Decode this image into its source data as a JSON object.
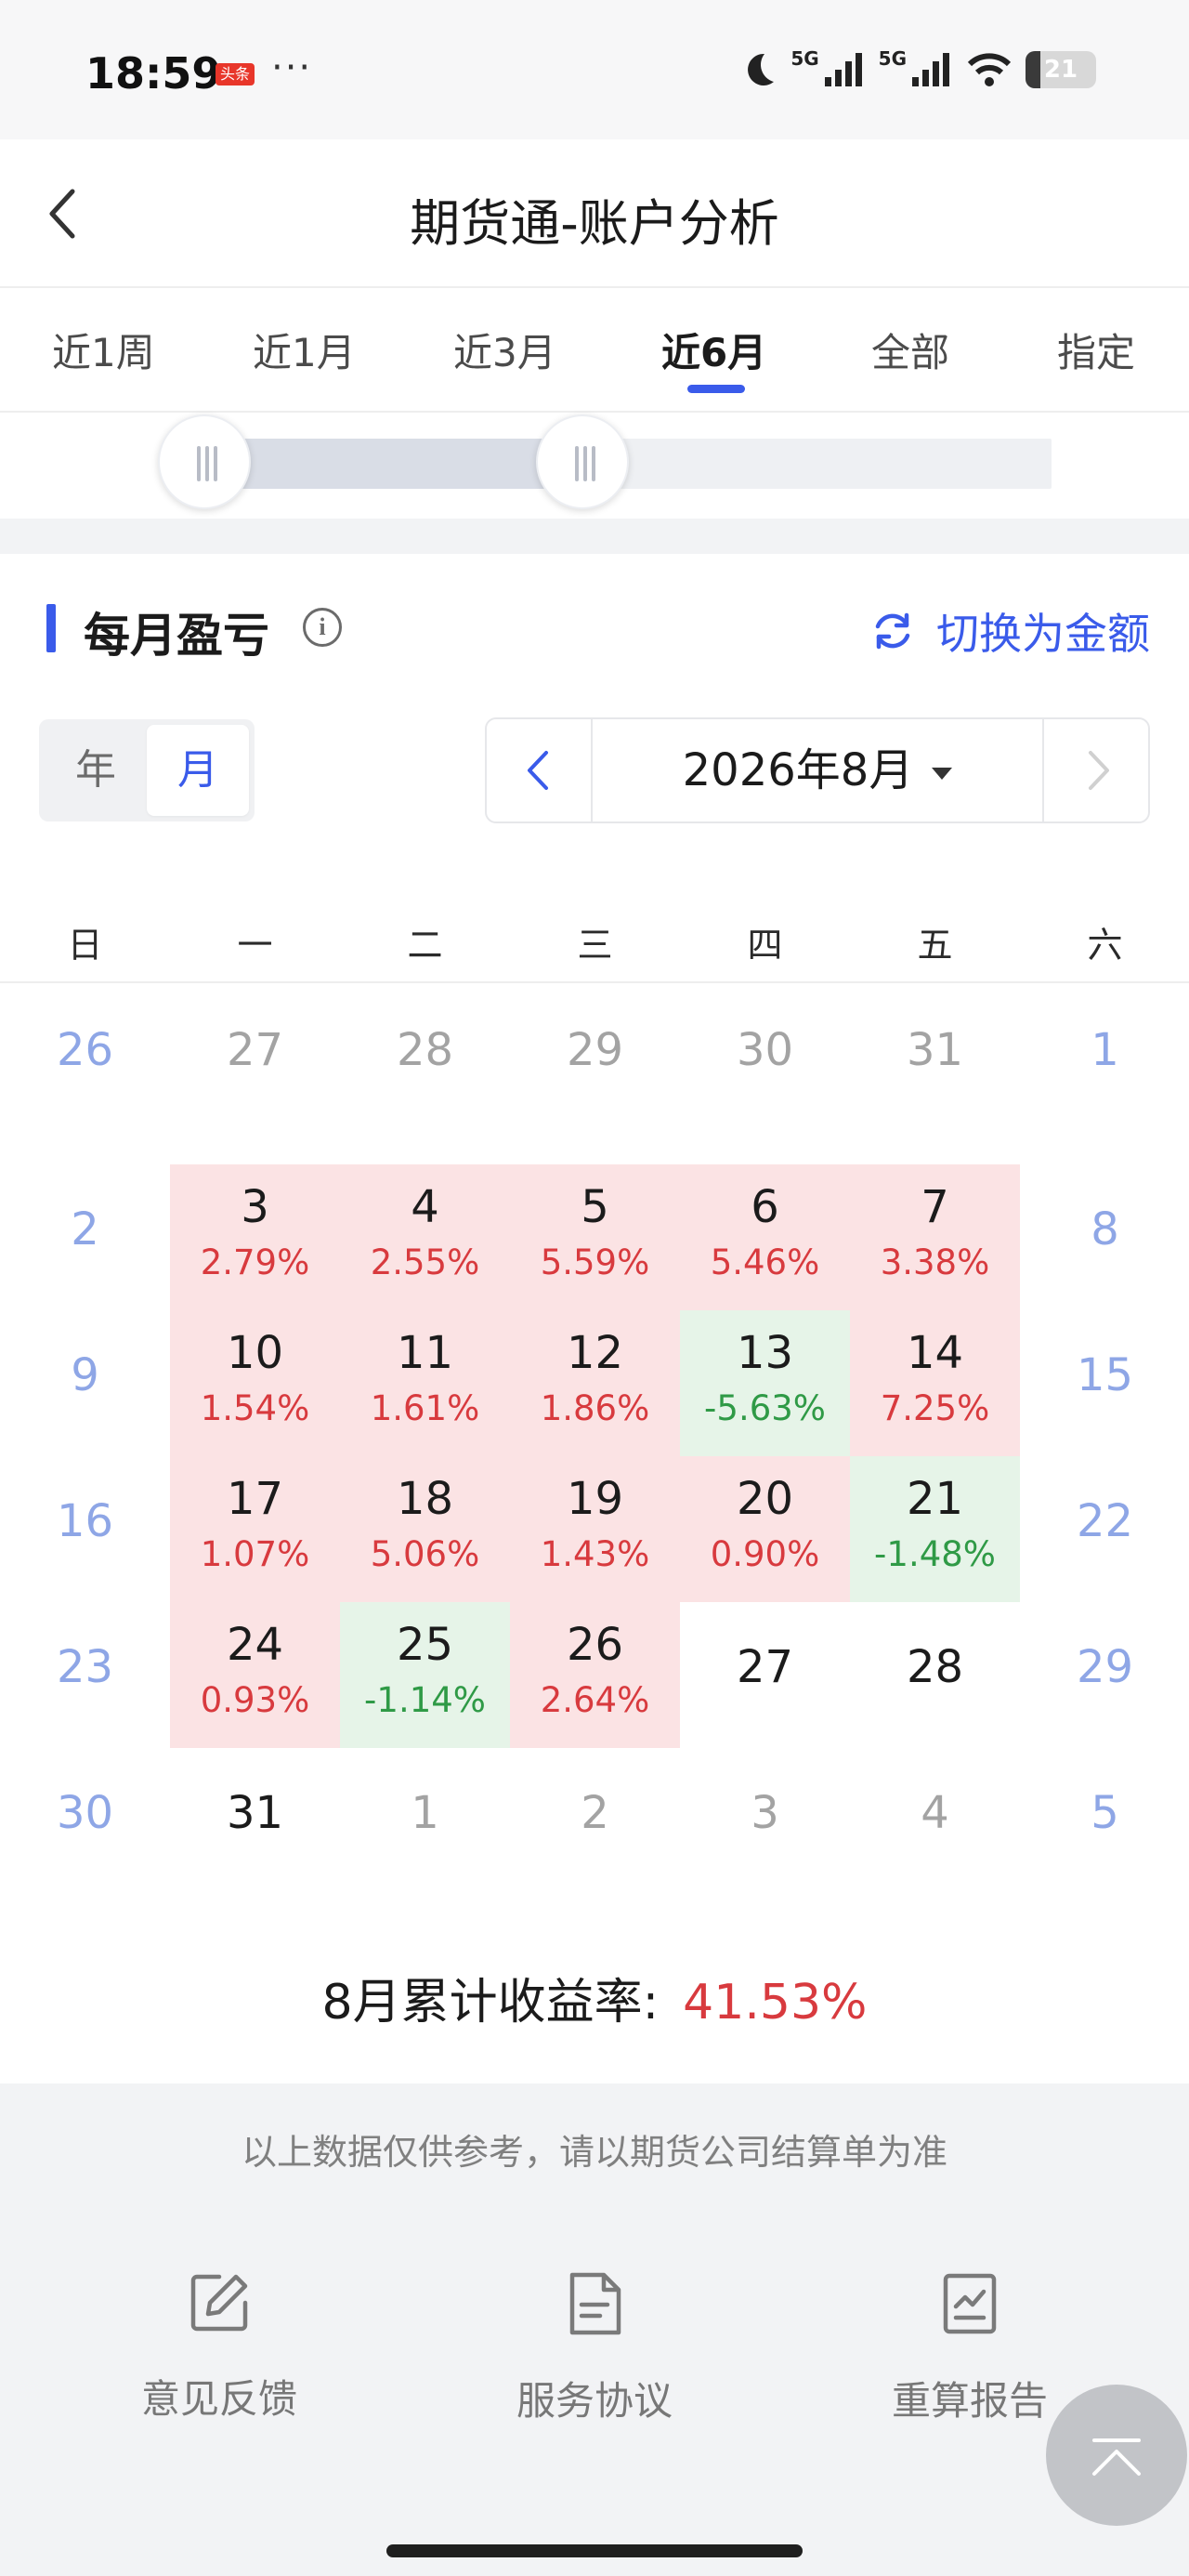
{
  "status_bar": {
    "time": "18:59",
    "badge": "头条",
    "more": "···",
    "network1": "5G",
    "network2": "5G",
    "battery": "21"
  },
  "header": {
    "title": "期货通-账户分析"
  },
  "tabs": [
    {
      "label": "近1周",
      "active": false
    },
    {
      "label": "近1月",
      "active": false
    },
    {
      "label": "近3月",
      "active": false
    },
    {
      "label": "近6月",
      "active": true
    },
    {
      "label": "全部",
      "active": false
    },
    {
      "label": "指定",
      "active": false
    }
  ],
  "range": {
    "start_fraction": 0.0,
    "end_fraction": 0.26
  },
  "section": {
    "title": "每月盈亏",
    "info_icon": "info-icon",
    "switch_label": "切换为金额"
  },
  "segment": {
    "year": "年",
    "month": "月",
    "selected": "月"
  },
  "picker": {
    "label": "2026年8月"
  },
  "weekdays": [
    "日",
    "一",
    "二",
    "三",
    "四",
    "五",
    "六"
  ],
  "calendar": [
    [
      {
        "day": "26",
        "kind": "weekend"
      },
      {
        "day": "27",
        "kind": "faded"
      },
      {
        "day": "28",
        "kind": "faded"
      },
      {
        "day": "29",
        "kind": "faded"
      },
      {
        "day": "30",
        "kind": "faded"
      },
      {
        "day": "31",
        "kind": "faded"
      },
      {
        "day": "1",
        "kind": "weekend"
      }
    ],
    [
      {
        "day": "2",
        "kind": "weekend"
      },
      {
        "day": "3",
        "kind": "normal",
        "pct": "2.79%",
        "sign": "pos"
      },
      {
        "day": "4",
        "kind": "normal",
        "pct": "2.55%",
        "sign": "pos"
      },
      {
        "day": "5",
        "kind": "normal",
        "pct": "5.59%",
        "sign": "pos"
      },
      {
        "day": "6",
        "kind": "normal",
        "pct": "5.46%",
        "sign": "pos"
      },
      {
        "day": "7",
        "kind": "normal",
        "pct": "3.38%",
        "sign": "pos"
      },
      {
        "day": "8",
        "kind": "weekend"
      }
    ],
    [
      {
        "day": "9",
        "kind": "weekend"
      },
      {
        "day": "10",
        "kind": "normal",
        "pct": "1.54%",
        "sign": "pos"
      },
      {
        "day": "11",
        "kind": "normal",
        "pct": "1.61%",
        "sign": "pos"
      },
      {
        "day": "12",
        "kind": "normal",
        "pct": "1.86%",
        "sign": "pos"
      },
      {
        "day": "13",
        "kind": "normal",
        "pct": "-5.63%",
        "sign": "neg"
      },
      {
        "day": "14",
        "kind": "normal",
        "pct": "7.25%",
        "sign": "pos"
      },
      {
        "day": "15",
        "kind": "weekend"
      }
    ],
    [
      {
        "day": "16",
        "kind": "weekend"
      },
      {
        "day": "17",
        "kind": "normal",
        "pct": "1.07%",
        "sign": "pos"
      },
      {
        "day": "18",
        "kind": "normal",
        "pct": "5.06%",
        "sign": "pos"
      },
      {
        "day": "19",
        "kind": "normal",
        "pct": "1.43%",
        "sign": "pos"
      },
      {
        "day": "20",
        "kind": "normal",
        "pct": "0.90%",
        "sign": "pos"
      },
      {
        "day": "21",
        "kind": "normal",
        "pct": "-1.48%",
        "sign": "neg"
      },
      {
        "day": "22",
        "kind": "weekend"
      }
    ],
    [
      {
        "day": "23",
        "kind": "weekend"
      },
      {
        "day": "24",
        "kind": "normal",
        "pct": "0.93%",
        "sign": "pos"
      },
      {
        "day": "25",
        "kind": "normal",
        "pct": "-1.14%",
        "sign": "neg"
      },
      {
        "day": "26",
        "kind": "normal",
        "pct": "2.64%",
        "sign": "pos"
      },
      {
        "day": "27",
        "kind": "normal"
      },
      {
        "day": "28",
        "kind": "normal"
      },
      {
        "day": "29",
        "kind": "weekend"
      }
    ],
    [
      {
        "day": "30",
        "kind": "weekend"
      },
      {
        "day": "31",
        "kind": "normal"
      },
      {
        "day": "1",
        "kind": "faded"
      },
      {
        "day": "2",
        "kind": "faded"
      },
      {
        "day": "3",
        "kind": "faded"
      },
      {
        "day": "4",
        "kind": "faded"
      },
      {
        "day": "5",
        "kind": "weekend"
      }
    ]
  ],
  "summary": {
    "label": "8月累计收益率:",
    "value": "41.53%"
  },
  "footer": {
    "disclaimer": "以上数据仅供参考，请以期货公司结算单为准",
    "items": [
      {
        "label": "意见反馈",
        "icon": "edit-icon"
      },
      {
        "label": "服务协议",
        "icon": "document-icon"
      },
      {
        "label": "重算报告",
        "icon": "report-chart-icon"
      }
    ]
  },
  "colors": {
    "accent": "#3a5bea",
    "gain_text": "#d83a3e",
    "loss_text": "#2f9a46",
    "gain_bg": "#fbe3e4",
    "loss_bg": "#e6f4e8",
    "weekend_text": "#8ea6e6"
  }
}
